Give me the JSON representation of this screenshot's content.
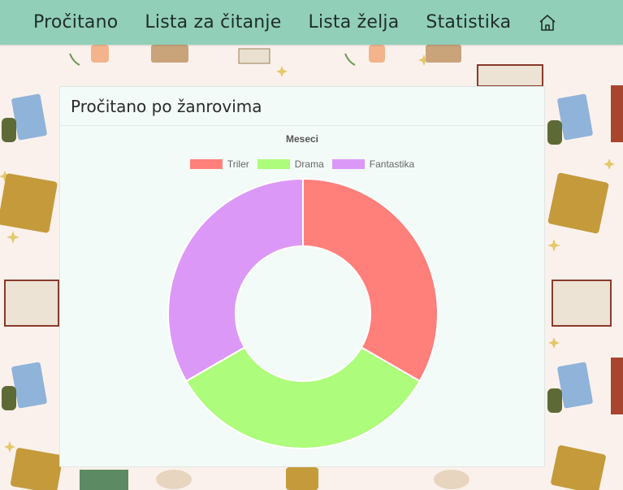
{
  "navbar": {
    "items": [
      {
        "label": "Pročitano"
      },
      {
        "label": "Lista za čitanje"
      },
      {
        "label": "Lista želja"
      },
      {
        "label": "Statistika"
      }
    ],
    "home_icon": "home-icon"
  },
  "card": {
    "title": "Pročitano po žanrovima"
  },
  "chart_data": {
    "type": "pie",
    "title": "Meseci",
    "categories": [
      "Triler",
      "Drama",
      "Fantastika"
    ],
    "values": [
      1,
      1,
      1
    ],
    "colors": [
      "#ff7f7b",
      "#adfc7b",
      "#dc98f7"
    ],
    "legend_position": "top",
    "doughnut": true
  },
  "colors": {
    "navbar": "#92cfb9",
    "card_background": "#f3fbf8",
    "page_background": "#fbf1ec"
  }
}
